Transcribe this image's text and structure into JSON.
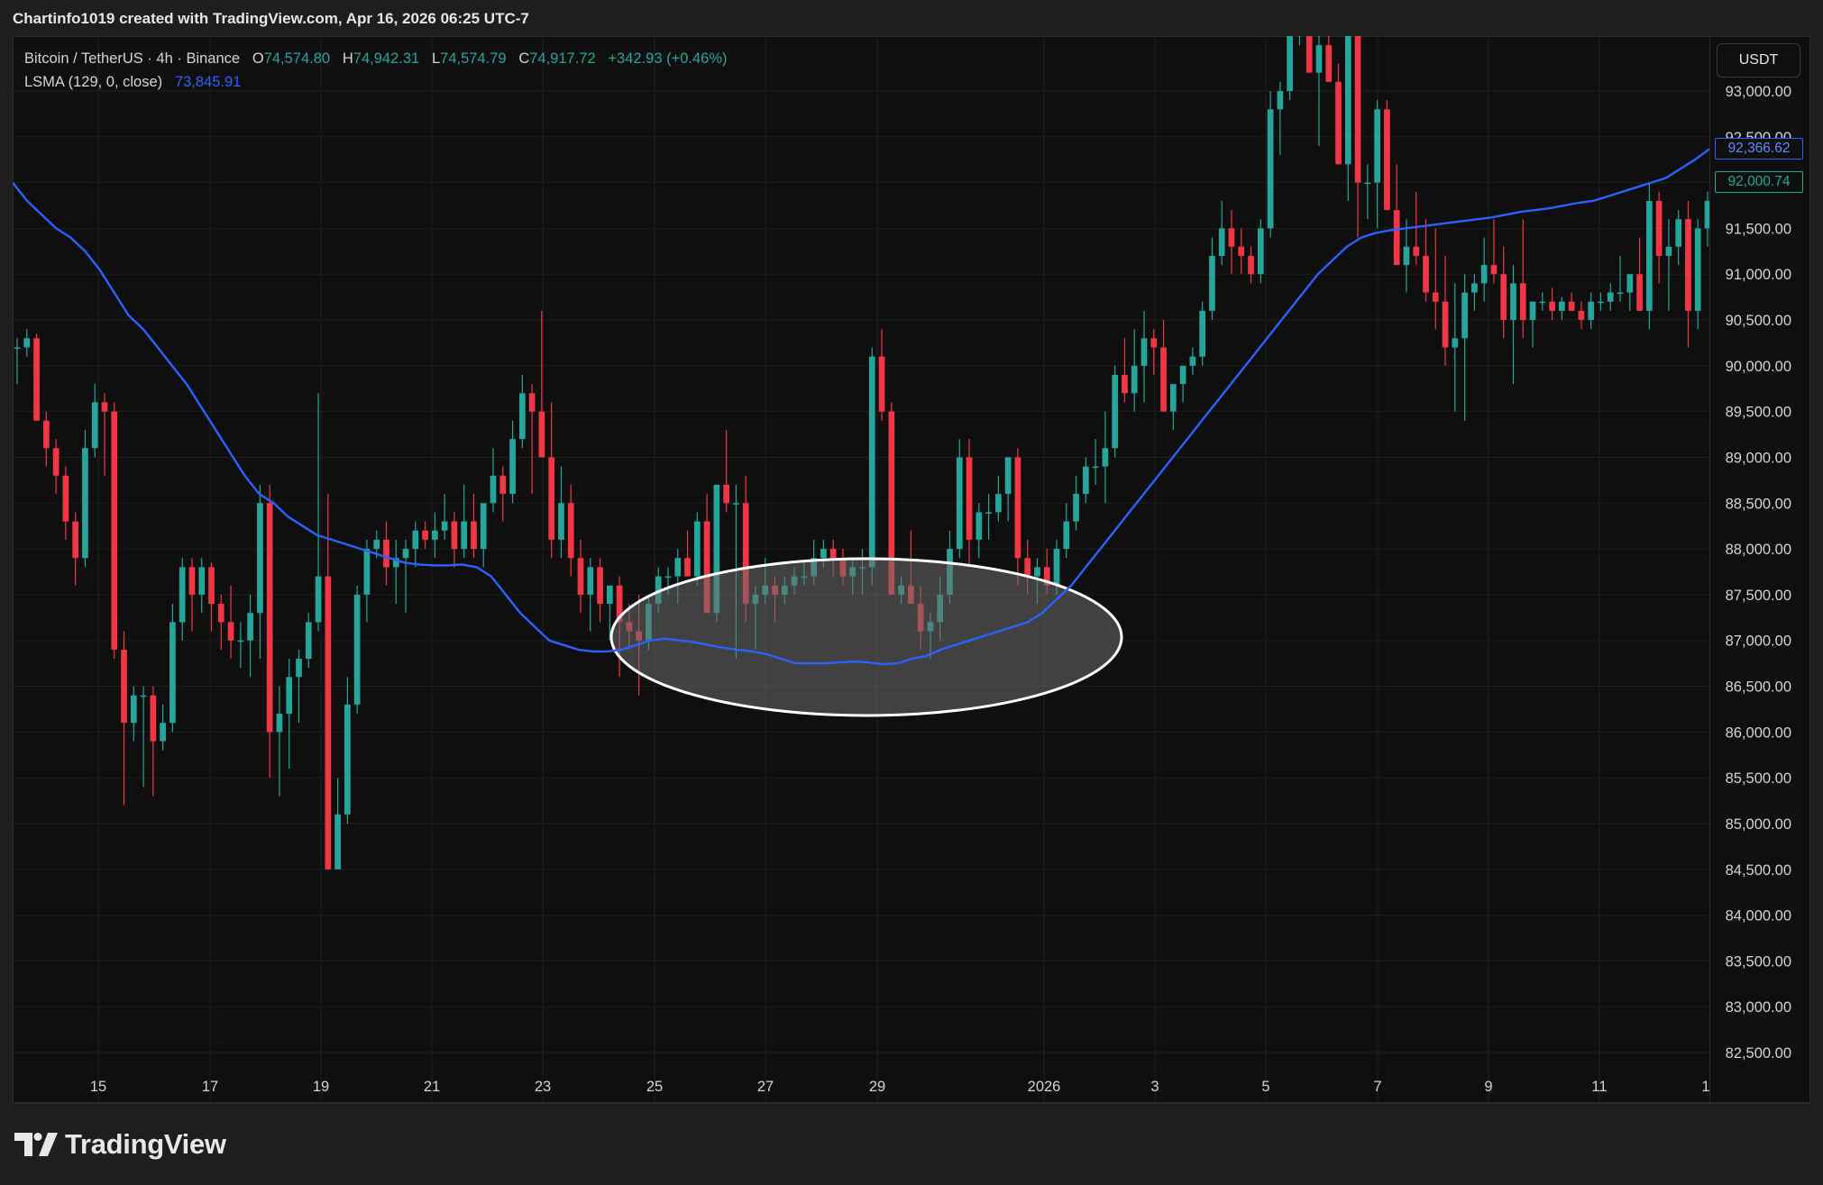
{
  "header": {
    "credit": "Chartinfo1019 created with TradingView.com, Apr 16, 2026 06:25 UTC-7"
  },
  "legend": {
    "symbol": "Bitcoin / TetherUS · 4h · Binance",
    "open_key": "O",
    "open": "74,574.80",
    "high_key": "H",
    "high": "74,942.31",
    "low_key": "L",
    "low": "74,574.79",
    "close_key": "C",
    "close": "74,917.72",
    "change": "+342.93 (+0.46%)",
    "indicator": "LSMA (129, 0, close)",
    "indicator_value": "73,845.91"
  },
  "currency_button": "USDT",
  "price_tags": {
    "lsma": "92,366.62",
    "last": "92,000.74"
  },
  "footer": {
    "brand": "TradingView"
  },
  "colors": {
    "up": "#26a69a",
    "down": "#f23645",
    "lsma": "#2962ff",
    "grid": "#1f1f1f",
    "background": "#0f0f0f",
    "ellipse_fill": "#6b6b6b",
    "ellipse_stroke": "#ffffff"
  },
  "chart_data": {
    "type": "candlestick",
    "interval": "4h",
    "x_ticks": [
      "15",
      "17",
      "19",
      "21",
      "23",
      "25",
      "27",
      "29",
      "2026",
      "3",
      "5",
      "7",
      "9",
      "11",
      "1"
    ],
    "y_ticks": [
      93000,
      92500,
      92000,
      91500,
      91000,
      90500,
      90000,
      89500,
      89000,
      88500,
      88000,
      87500,
      87000,
      86500,
      86000,
      85500,
      85000,
      84500,
      84000,
      83500,
      83000,
      82500
    ],
    "ylim": [
      82200,
      93500
    ],
    "candles": [
      [
        90200,
        90300,
        89800,
        90200
      ],
      [
        90200,
        90400,
        90100,
        90300
      ],
      [
        90300,
        90350,
        89500,
        89400
      ],
      [
        89400,
        89500,
        88900,
        89100
      ],
      [
        89100,
        89200,
        88600,
        88800
      ],
      [
        88800,
        88900,
        88100,
        88300
      ],
      [
        88300,
        88400,
        87600,
        87900
      ],
      [
        87900,
        89300,
        87800,
        89100
      ],
      [
        89100,
        89800,
        89000,
        89600
      ],
      [
        89600,
        89700,
        88800,
        89500
      ],
      [
        89500,
        89600,
        86800,
        86900
      ],
      [
        86900,
        87100,
        85200,
        86100
      ],
      [
        86100,
        86500,
        85900,
        86400
      ],
      [
        86400,
        86500,
        85400,
        86400
      ],
      [
        86400,
        86500,
        85300,
        85900
      ],
      [
        85900,
        86300,
        85800,
        86100
      ],
      [
        86100,
        87400,
        86000,
        87200
      ],
      [
        87200,
        87900,
        87000,
        87800
      ],
      [
        87800,
        87900,
        87100,
        87500
      ],
      [
        87500,
        87900,
        87300,
        87800
      ],
      [
        87800,
        87850,
        87100,
        87400
      ],
      [
        87400,
        87500,
        86900,
        87200
      ],
      [
        87200,
        87600,
        86800,
        87000
      ],
      [
        87000,
        87200,
        86700,
        87000
      ],
      [
        87000,
        87500,
        86600,
        87300
      ],
      [
        87300,
        88700,
        86800,
        88500
      ],
      [
        88500,
        88700,
        85500,
        86000
      ],
      [
        86000,
        86500,
        85300,
        86200
      ],
      [
        86200,
        86800,
        85600,
        86600
      ],
      [
        86600,
        86900,
        86100,
        86800
      ],
      [
        86800,
        87300,
        86700,
        87200
      ],
      [
        87200,
        89700,
        87100,
        87700
      ],
      [
        87700,
        88600,
        84500,
        84500
      ],
      [
        84500,
        85500,
        84500,
        85100
      ],
      [
        85100,
        86600,
        85000,
        86300
      ],
      [
        86300,
        87600,
        86200,
        87500
      ],
      [
        87500,
        88100,
        87200,
        88000
      ],
      [
        88000,
        88200,
        87900,
        88100
      ],
      [
        88100,
        88300,
        87600,
        87800
      ],
      [
        87800,
        88100,
        87400,
        87900
      ],
      [
        87900,
        88100,
        87300,
        88000
      ],
      [
        88000,
        88300,
        87800,
        88200
      ],
      [
        88200,
        88300,
        88000,
        88100
      ],
      [
        88100,
        88400,
        87900,
        88200
      ],
      [
        88200,
        88600,
        88100,
        88300
      ],
      [
        88300,
        88400,
        87800,
        88000
      ],
      [
        88000,
        88700,
        87900,
        88300
      ],
      [
        88300,
        88600,
        87900,
        88000
      ],
      [
        88000,
        88500,
        87800,
        88500
      ],
      [
        88500,
        89100,
        88400,
        88800
      ],
      [
        88800,
        88900,
        88300,
        88600
      ],
      [
        88600,
        89400,
        88500,
        89200
      ],
      [
        89200,
        89900,
        89100,
        89700
      ],
      [
        89700,
        89800,
        88600,
        89500
      ],
      [
        89500,
        90600,
        89300,
        89000
      ],
      [
        89000,
        89600,
        87900,
        88100
      ],
      [
        88100,
        88900,
        87900,
        88500
      ],
      [
        88500,
        88700,
        87700,
        87900
      ],
      [
        87900,
        88100,
        87300,
        87500
      ],
      [
        87500,
        87900,
        87100,
        87800
      ],
      [
        87800,
        87900,
        87200,
        87400
      ],
      [
        87400,
        87600,
        87000,
        87600
      ],
      [
        87600,
        87700,
        86600,
        87200
      ],
      [
        87200,
        87400,
        86900,
        87100
      ],
      [
        87100,
        87500,
        86400,
        87000
      ],
      [
        87000,
        87500,
        86900,
        87400
      ],
      [
        87400,
        87800,
        87300,
        87700
      ],
      [
        87700,
        87800,
        87500,
        87700
      ],
      [
        87700,
        88000,
        87400,
        87900
      ],
      [
        87900,
        88200,
        87800,
        87700
      ],
      [
        87700,
        88400,
        87600,
        88300
      ],
      [
        88300,
        88600,
        87500,
        87300
      ],
      [
        87300,
        88500,
        87200,
        88700
      ],
      [
        88700,
        89300,
        88400,
        88500
      ],
      [
        88500,
        88700,
        86800,
        88500
      ],
      [
        88500,
        88800,
        87200,
        87400
      ],
      [
        87400,
        87600,
        86900,
        87500
      ],
      [
        87500,
        87900,
        87400,
        87600
      ],
      [
        87600,
        87700,
        87200,
        87500
      ],
      [
        87500,
        87700,
        87400,
        87600
      ],
      [
        87600,
        87800,
        87500,
        87700
      ],
      [
        87700,
        87850,
        87600,
        87700
      ],
      [
        87700,
        88100,
        87600,
        87900
      ],
      [
        87900,
        88100,
        87800,
        88000
      ],
      [
        88000,
        88100,
        87700,
        87900
      ],
      [
        87900,
        88000,
        87600,
        87700
      ],
      [
        87700,
        87900,
        87500,
        87800
      ],
      [
        87800,
        88000,
        87500,
        87800
      ],
      [
        87800,
        90200,
        87600,
        90100
      ],
      [
        90100,
        90400,
        89400,
        89500
      ],
      [
        89500,
        89600,
        87700,
        87500
      ],
      [
        87500,
        87700,
        87400,
        87600
      ],
      [
        87600,
        88200,
        87400,
        87400
      ],
      [
        87400,
        87600,
        86900,
        87100
      ],
      [
        87100,
        87300,
        86800,
        87200
      ],
      [
        87200,
        87700,
        87000,
        87500
      ],
      [
        87500,
        88200,
        87400,
        88000
      ],
      [
        88000,
        89200,
        87900,
        89000
      ],
      [
        89000,
        89200,
        87800,
        88100
      ],
      [
        88100,
        88500,
        87900,
        88400
      ],
      [
        88400,
        88600,
        88100,
        88400
      ],
      [
        88400,
        88800,
        88300,
        88600
      ],
      [
        88600,
        89000,
        88300,
        89000
      ],
      [
        89000,
        89100,
        87600,
        87900
      ],
      [
        87900,
        88100,
        87500,
        87700
      ],
      [
        87700,
        87900,
        87400,
        87800
      ],
      [
        87800,
        88000,
        87500,
        87600
      ],
      [
        87600,
        88100,
        87500,
        88000
      ],
      [
        88000,
        88500,
        87900,
        88300
      ],
      [
        88300,
        88800,
        88200,
        88600
      ],
      [
        88600,
        89000,
        88500,
        88900
      ],
      [
        88900,
        89200,
        88700,
        88900
      ],
      [
        88900,
        89500,
        88500,
        89100
      ],
      [
        89100,
        90000,
        89000,
        89900
      ],
      [
        89900,
        90300,
        89600,
        89700
      ],
      [
        89700,
        90400,
        89500,
        90000
      ],
      [
        90000,
        90600,
        89600,
        90300
      ],
      [
        90300,
        90400,
        89900,
        90200
      ],
      [
        90200,
        90500,
        89500,
        89500
      ],
      [
        89500,
        89700,
        89300,
        89800
      ],
      [
        89800,
        90000,
        89600,
        90000
      ],
      [
        90000,
        90200,
        89900,
        90100
      ],
      [
        90100,
        90700,
        90000,
        90600
      ],
      [
        90600,
        91400,
        90500,
        91200
      ],
      [
        91200,
        91800,
        91100,
        91500
      ],
      [
        91500,
        91700,
        91000,
        91300
      ],
      [
        91300,
        91500,
        91000,
        91200
      ],
      [
        91200,
        91300,
        90900,
        91000
      ],
      [
        91000,
        91600,
        90900,
        91500
      ],
      [
        91500,
        93000,
        91400,
        92800
      ],
      [
        92800,
        93100,
        92300,
        93000
      ],
      [
        93000,
        93800,
        92900,
        93600
      ],
      [
        93600,
        94200,
        93500,
        94000
      ],
      [
        94000,
        94100,
        93300,
        93200
      ],
      [
        93200,
        93700,
        92400,
        93500
      ],
      [
        93500,
        93800,
        93100,
        93100
      ],
      [
        93100,
        93300,
        92900,
        92200
      ],
      [
        92200,
        93600,
        91800,
        93800
      ],
      [
        93800,
        93500,
        91400,
        92000
      ],
      [
        92000,
        92200,
        91600,
        92000
      ],
      [
        92000,
        92900,
        91500,
        92800
      ],
      [
        92800,
        92900,
        92000,
        91700
      ],
      [
        91700,
        92200,
        91100,
        91100
      ],
      [
        91100,
        91600,
        90800,
        91300
      ],
      [
        91300,
        91900,
        91100,
        91200
      ],
      [
        91200,
        91600,
        90700,
        90800
      ],
      [
        90800,
        91500,
        90400,
        90700
      ],
      [
        90700,
        91200,
        90000,
        90200
      ],
      [
        90200,
        90900,
        89500,
        90300
      ],
      [
        90300,
        91000,
        89400,
        90800
      ],
      [
        90800,
        91000,
        90600,
        90900
      ],
      [
        90900,
        91400,
        90700,
        91100
      ],
      [
        91100,
        91600,
        90900,
        91000
      ],
      [
        91000,
        91300,
        90300,
        90500
      ],
      [
        90500,
        91100,
        89800,
        90900
      ],
      [
        90900,
        91600,
        90300,
        90500
      ],
      [
        90500,
        90700,
        90200,
        90700
      ],
      [
        90700,
        90800,
        90600,
        90700
      ],
      [
        90700,
        90850,
        90500,
        90600
      ],
      [
        90600,
        90750,
        90500,
        90700
      ],
      [
        90700,
        90800,
        90600,
        90600
      ],
      [
        90600,
        90700,
        90400,
        90500
      ],
      [
        90500,
        90800,
        90400,
        90700
      ],
      [
        90700,
        90800,
        90600,
        90700
      ],
      [
        90700,
        90900,
        90600,
        90800
      ],
      [
        90800,
        91200,
        90700,
        90800
      ],
      [
        90800,
        91000,
        90600,
        91000
      ],
      [
        91000,
        91400,
        90800,
        90600
      ],
      [
        90600,
        92000,
        90400,
        91800
      ],
      [
        91800,
        91900,
        90900,
        91200
      ],
      [
        91200,
        91600,
        90600,
        91300
      ],
      [
        91300,
        91700,
        91100,
        91600
      ],
      [
        91600,
        91800,
        90200,
        90600
      ],
      [
        90600,
        91600,
        90400,
        91500
      ],
      [
        91500,
        91900,
        91300,
        91800
      ]
    ],
    "lsma_series": [
      92000,
      91800,
      91650,
      91500,
      91400,
      91250,
      91050,
      90800,
      90550,
      90400,
      90200,
      90000,
      89800,
      89550,
      89300,
      89050,
      88800,
      88600,
      88500,
      88350,
      88250,
      88150,
      88100,
      88050,
      88000,
      87950,
      87900,
      87850,
      87830,
      87820,
      87820,
      87830,
      87800,
      87700,
      87500,
      87300,
      87150,
      87000,
      86950,
      86900,
      86880,
      86880,
      86900,
      86950,
      87000,
      87020,
      87000,
      86980,
      86950,
      86920,
      86900,
      86880,
      86850,
      86800,
      86750,
      86750,
      86750,
      86760,
      86770,
      86760,
      86740,
      86750,
      86800,
      86830,
      86900,
      86950,
      87000,
      87050,
      87100,
      87150,
      87200,
      87300,
      87450,
      87600,
      87800,
      88000,
      88200,
      88400,
      88600,
      88800,
      89000,
      89200,
      89400,
      89600,
      89800,
      90000,
      90200,
      90400,
      90600,
      90800,
      91000,
      91150,
      91300,
      91400,
      91450,
      91480,
      91500,
      91520,
      91540,
      91560,
      91580,
      91600,
      91620,
      91650,
      91680,
      91700,
      91720,
      91750,
      91780,
      91800,
      91850,
      91900,
      91950,
      92000,
      92050,
      92150,
      92250,
      92366
    ]
  }
}
